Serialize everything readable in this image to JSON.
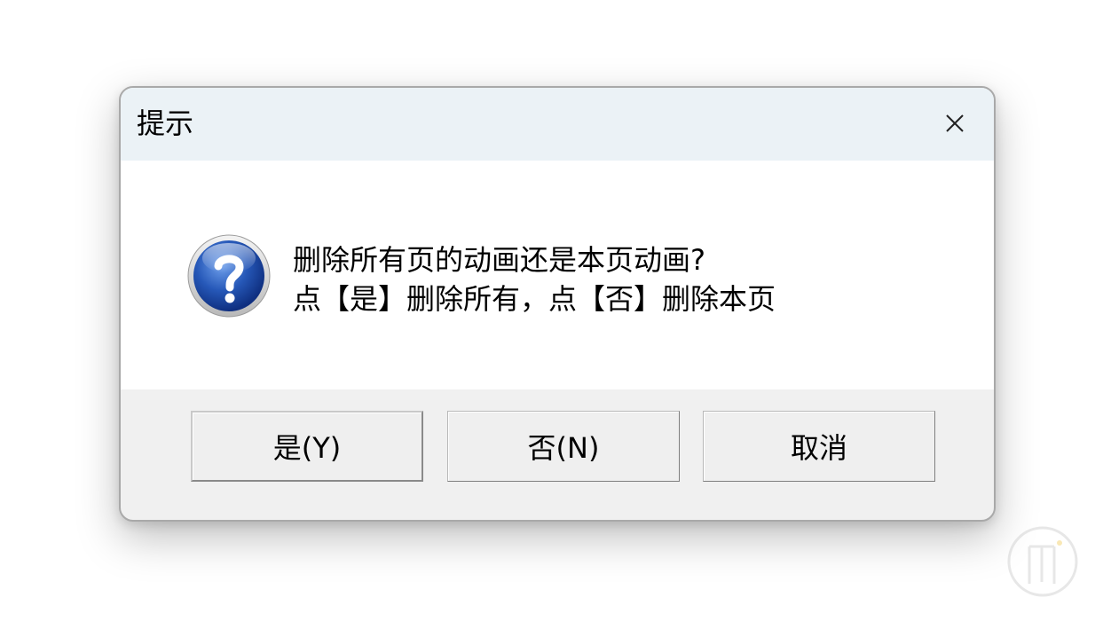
{
  "dialog": {
    "title": "提示",
    "close_icon": "close-icon",
    "message_icon": "question-icon",
    "message_line1": "删除所有页的动画还是本页动画?",
    "message_line2": "点【是】删除所有，点【否】删除本页",
    "buttons": {
      "yes": "是(Y)",
      "no": "否(N)",
      "cancel": "取消"
    }
  },
  "colors": {
    "titlebar_bg": "#ebf2f6",
    "content_bg": "#ffffff",
    "footer_bg": "#f0f0f0",
    "icon_blue": "#1e4fa8"
  }
}
